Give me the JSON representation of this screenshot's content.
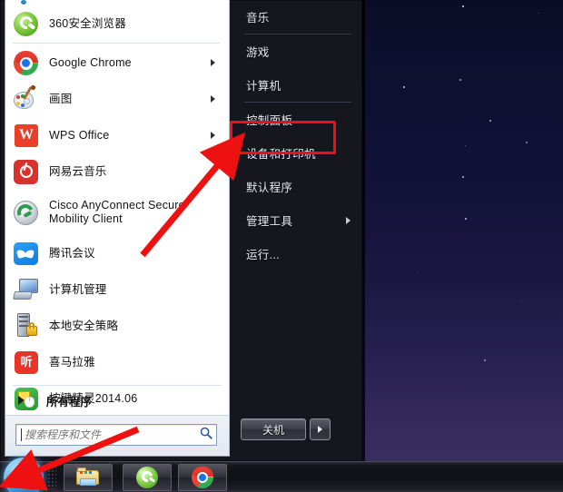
{
  "os": {
    "name": "windows-7-start-menu",
    "accent_red": "#ee1111",
    "menu_dark": "#16161f",
    "pane_white": "#ffffff"
  },
  "start_menu": {
    "programs": [
      {
        "id": "p0",
        "label": "",
        "icon": "partial-icon",
        "submenu": false,
        "partial": true
      },
      {
        "id": "p1",
        "label": "360安全浏览器",
        "icon": "360-browser-icon",
        "submenu": false
      },
      {
        "id": "p2",
        "label": "Google Chrome",
        "icon": "chrome-icon",
        "submenu": true
      },
      {
        "id": "p3",
        "label": "画图",
        "icon": "paint-icon",
        "submenu": true
      },
      {
        "id": "p4",
        "label": "WPS Office",
        "icon": "wps-office-icon",
        "submenu": true
      },
      {
        "id": "p5",
        "label": "网易云音乐",
        "icon": "netease-music-icon",
        "submenu": false
      },
      {
        "id": "p6",
        "label": "Cisco AnyConnect Secure Mobility Client",
        "icon": "cisco-anyconnect-icon",
        "submenu": false,
        "two_line": true
      },
      {
        "id": "p7",
        "label": "腾讯会议",
        "icon": "tencent-meeting-icon",
        "submenu": false
      },
      {
        "id": "p8",
        "label": "计算机管理",
        "icon": "computer-management-icon",
        "submenu": false
      },
      {
        "id": "p9",
        "label": "本地安全策略",
        "icon": "local-security-policy-icon",
        "submenu": false
      },
      {
        "id": "p10",
        "label": "喜马拉雅",
        "icon": "ximalaya-icon",
        "submenu": false
      },
      {
        "id": "p11",
        "label": "按键精灵2014.06",
        "icon": "anjian-jingling-icon",
        "submenu": false
      }
    ],
    "all_programs": {
      "label": "所有程序",
      "icon": "right-triangle-icon"
    },
    "search": {
      "value": "",
      "placeholder": "搜索程序和文件",
      "icon": "search-icon"
    },
    "places": [
      {
        "id": "r0",
        "label": "音乐",
        "submenu": false,
        "sep_after": true
      },
      {
        "id": "r1",
        "label": "游戏",
        "submenu": false,
        "sep_after": false
      },
      {
        "id": "r2",
        "label": "计算机",
        "submenu": false,
        "sep_after": true
      },
      {
        "id": "r3",
        "label": "控制面板",
        "submenu": false,
        "sep_after": false
      },
      {
        "id": "r4",
        "label": "设备和打印机",
        "submenu": false,
        "sep_after": false,
        "highlighted": true
      },
      {
        "id": "r5",
        "label": "默认程序",
        "submenu": false,
        "sep_after": false
      },
      {
        "id": "r6",
        "label": "管理工具",
        "submenu": true,
        "sep_after": false
      },
      {
        "id": "r7",
        "label": "运行...",
        "submenu": false,
        "sep_after": false
      }
    ],
    "shutdown": {
      "label": "关机",
      "more_icon": "chevron-right-icon"
    }
  },
  "taskbar": {
    "start_button": {
      "label": "",
      "icon": "windows-start-orb-icon"
    },
    "buttons": [
      {
        "id": "t1",
        "label": "",
        "icon": "file-explorer-icon"
      },
      {
        "id": "t2",
        "label": "",
        "icon": "ie-360-browser-icon"
      },
      {
        "id": "t3",
        "label": "",
        "icon": "chrome-icon"
      }
    ]
  },
  "annotations": {
    "highlight_box": {
      "target": "设备和打印机",
      "color": "#ee1111"
    },
    "arrow_to_menu_item": {
      "target": "设备和打印机",
      "color": "#ee1111"
    },
    "arrow_to_start_button": {
      "target": "windows-start-orb-icon",
      "color": "#ee1111"
    }
  },
  "desktop": {
    "wallpaper": "starry-night-gradient"
  }
}
